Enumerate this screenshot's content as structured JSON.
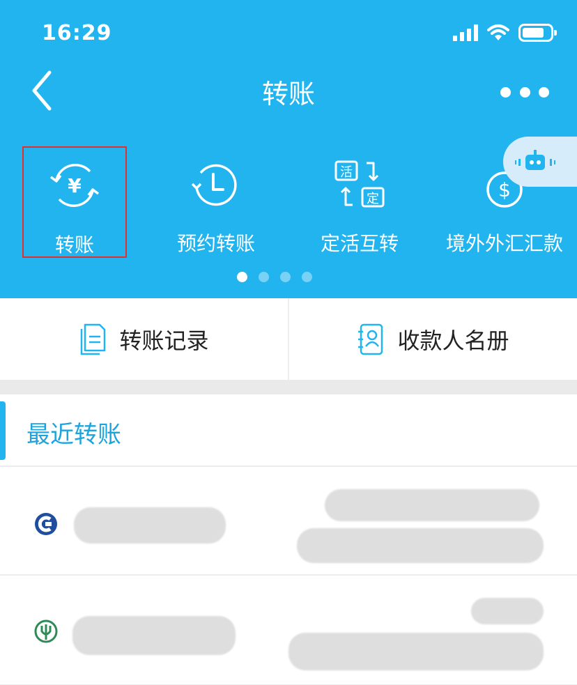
{
  "status_bar": {
    "time": "16:29"
  },
  "nav": {
    "title": "转账"
  },
  "functions": [
    {
      "label": "转账",
      "icon": "yen-transfer-icon",
      "selected": true
    },
    {
      "label": "预约转账",
      "icon": "scheduled-clock-icon"
    },
    {
      "label": "定活互转",
      "icon": "swap-deposit-icon",
      "icon_text": [
        "活",
        "定"
      ]
    },
    {
      "label": "境外外汇汇款",
      "icon": "dollar-remit-icon"
    }
  ],
  "pager": {
    "count": 4,
    "active": 1
  },
  "quick_actions": [
    {
      "label": "转账记录",
      "icon": "document-icon"
    },
    {
      "label": "收款人名册",
      "icon": "contacts-book-icon"
    }
  ],
  "recent": {
    "title": "最近转账"
  },
  "colors": {
    "brand": "#21b4ef",
    "accent_text": "#1ea4dc",
    "highlight_border": "#e0312f"
  }
}
